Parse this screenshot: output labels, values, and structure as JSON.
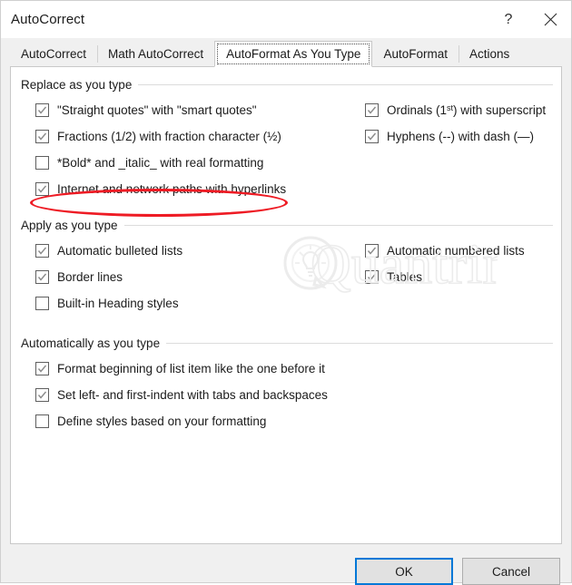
{
  "window": {
    "title": "AutoCorrect",
    "help_icon": "question-mark-icon",
    "close_icon": "close-icon"
  },
  "tabs": [
    {
      "label": "AutoCorrect",
      "active": false
    },
    {
      "label": "Math AutoCorrect",
      "active": false
    },
    {
      "label": "AutoFormat As You Type",
      "active": true
    },
    {
      "label": "AutoFormat",
      "active": false
    },
    {
      "label": "Actions",
      "active": false
    }
  ],
  "groups": [
    {
      "title": "Replace as you type",
      "left_items": [
        {
          "label": "\"Straight quotes\" with \"smart quotes\"",
          "checked": true,
          "highlighted": false
        },
        {
          "label": "Fractions (1/2) with fraction character (½)",
          "checked": true,
          "highlighted": true
        },
        {
          "label": "*Bold* and _italic_ with real formatting",
          "checked": false,
          "highlighted": false
        },
        {
          "label": "Internet and network paths with hyperlinks",
          "checked": true,
          "highlighted": false
        }
      ],
      "right_items": [
        {
          "label_pre": "Ordinals (1",
          "label_sup": "st",
          "label_post": ") with superscript",
          "checked": true
        },
        {
          "label": "Hyphens (--) with dash (—)",
          "checked": true
        }
      ]
    },
    {
      "title": "Apply as you type",
      "left_items": [
        {
          "label": "Automatic bulleted lists",
          "checked": true
        },
        {
          "label": "Border lines",
          "checked": true
        },
        {
          "label": "Built-in Heading styles",
          "checked": false
        }
      ],
      "right_items": [
        {
          "label": "Automatic numbered lists",
          "checked": true
        },
        {
          "label": "Tables",
          "checked": true
        }
      ]
    },
    {
      "title": "Automatically as you type",
      "left_items": [
        {
          "label": "Format beginning of list item like the one before it",
          "checked": true
        },
        {
          "label": "Set left- and first-indent with tabs and backspaces",
          "checked": true
        },
        {
          "label": "Define styles based on your formatting",
          "checked": false
        }
      ],
      "right_items": []
    }
  ],
  "footer": {
    "ok_label": "OK",
    "cancel_label": "Cancel"
  },
  "watermark": {
    "text": "Quantrimang"
  },
  "colors": {
    "accent": "#0078d7",
    "annotation": "#ee1b24",
    "dialog_bg": "#f0f0f0",
    "panel_bg": "#ffffff",
    "text": "#1b1b1b"
  }
}
